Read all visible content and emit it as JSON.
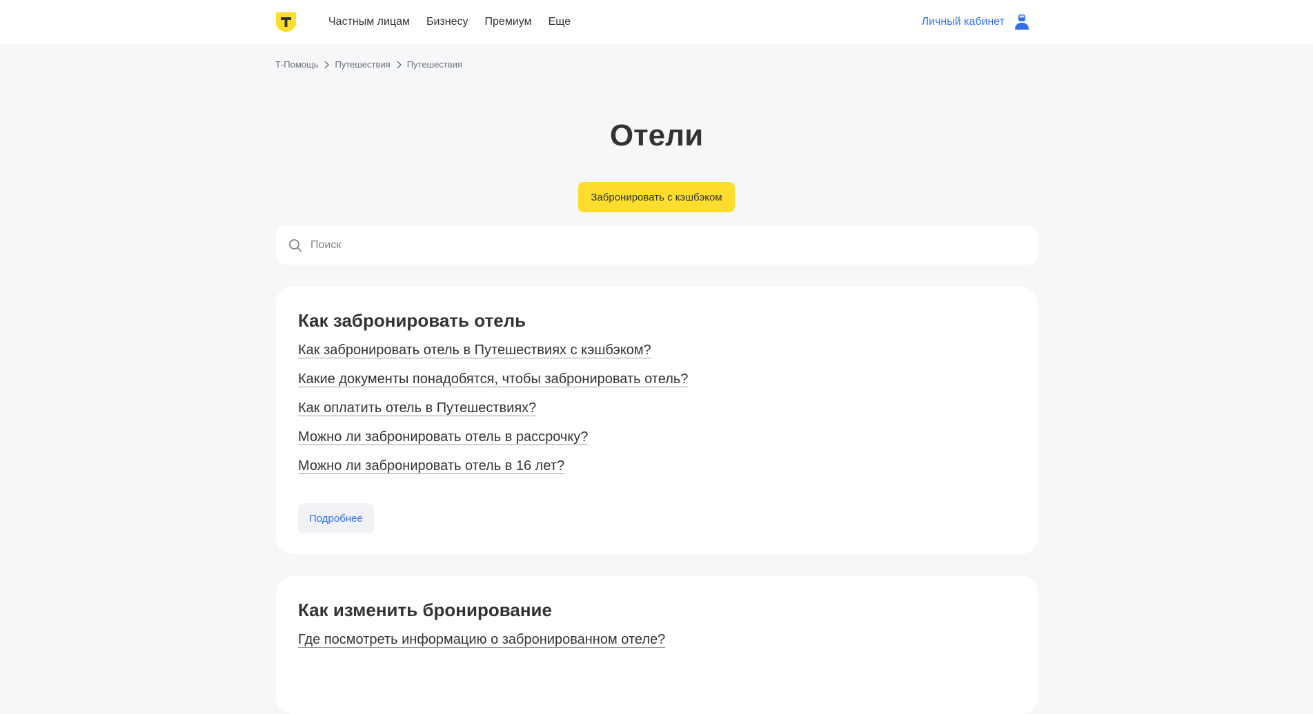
{
  "header": {
    "nav": [
      "Частным лицам",
      "Бизнесу",
      "Премиум",
      "Еще"
    ],
    "cabinet_label": "Личный кабинет"
  },
  "breadcrumb": [
    "Т-Помощь",
    "Путешествия",
    "Путешествия"
  ],
  "page_title": "Отели",
  "cta_label": "Забронировать с кэшбэком",
  "search": {
    "placeholder": "Поиск"
  },
  "sections": [
    {
      "title": "Как забронировать отель",
      "links": [
        "Как забронировать отель в Путешествиях с кэшбэком?",
        "Какие документы понадобятся, чтобы забронировать отель?",
        "Как оплатить отель в Путешествиях?",
        "Можно ли забронировать отель в рассрочку?",
        "Можно ли забронировать отель в 16 лет?"
      ],
      "more_label": "Подробнее"
    },
    {
      "title": "Как изменить бронирование",
      "links": [
        "Где посмотреть информацию о забронированном отеле?"
      ]
    }
  ],
  "colors": {
    "brand_yellow": "#ffdd2d",
    "link_blue": "#336fee",
    "page_bg": "#f6f7f8"
  }
}
